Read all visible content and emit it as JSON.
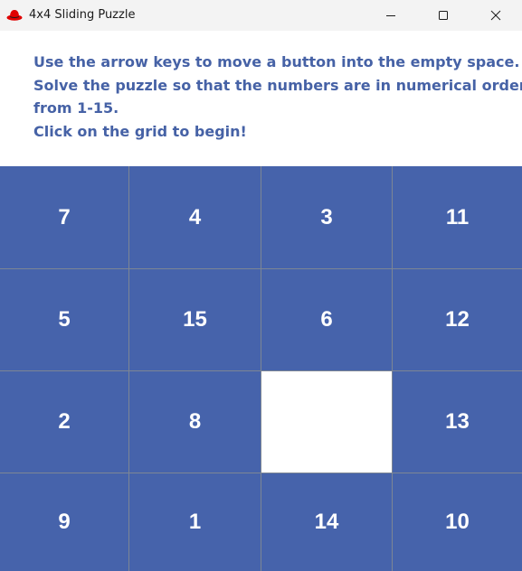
{
  "window": {
    "title": "4x4 Sliding Puzzle",
    "app_icon": "red-hat-icon",
    "controls": [
      "minimize-icon",
      "maximize-icon",
      "close-icon"
    ]
  },
  "instructions": {
    "line1": "Use the arrow keys to move a button into the empty space.",
    "line2": "Solve the puzzle so that the numbers are in numerical order",
    "line3": "from 1-15.",
    "line4": "Click on the grid to begin!"
  },
  "puzzle": {
    "rows": [
      [
        "7",
        "4",
        "3",
        "11"
      ],
      [
        "5",
        "15",
        "6",
        "12"
      ],
      [
        "2",
        "8",
        "",
        "13"
      ],
      [
        "9",
        "1",
        "14",
        "10"
      ]
    ]
  },
  "colors": {
    "tile": "#4663ab",
    "empty_tile": "#ffffff",
    "grid_lines": "#7d8694",
    "instruction_text": "#4662a6",
    "titlebar": "#f3f3f3"
  }
}
